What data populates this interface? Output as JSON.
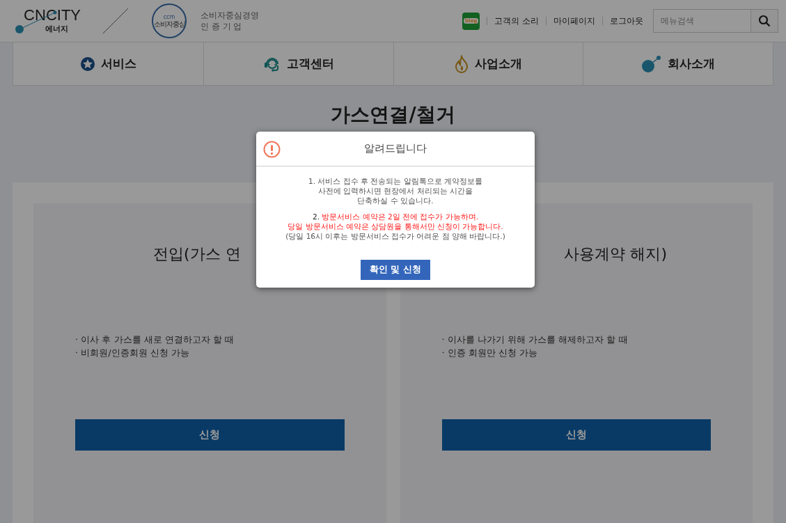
{
  "header": {
    "logo": {
      "brand": "CNCITY",
      "sub": "에너지"
    },
    "badge": {
      "top": "ccm",
      "main": "소비자중심"
    },
    "cert_lines": [
      "소비자중심경영",
      "인 증 기 업"
    ],
    "blog_label": "blog",
    "links": [
      "고객의 소리",
      "마이페이지",
      "로그아웃"
    ],
    "search": {
      "placeholder": "메뉴검색"
    }
  },
  "nav": [
    {
      "kind": "star",
      "label": "서비스"
    },
    {
      "kind": "headset",
      "label": "고객센터"
    },
    {
      "kind": "flame",
      "label": "사업소개"
    },
    {
      "kind": "dot",
      "label": "회사소개"
    }
  ],
  "page_title": "가스연결/철거",
  "cards": [
    {
      "title": "전입(가스 연",
      "bullets": [
        "· 이사 후 가스를 새로 연결하고자 할 때",
        "· 비회원/인증회원 신청 가능"
      ],
      "button": "신청"
    },
    {
      "title": "사용계약 해지)",
      "bullets": [
        "· 이사를 나가기 위해 가스를 해제하고자 할 때",
        "· 인증 회원만 신청 가능"
      ],
      "button": "신청"
    }
  ],
  "modal": {
    "title": "알려드립니다",
    "paragraphs": [
      {
        "kind": "plain",
        "lines": [
          "1. 서비스 접수 후 전송되는 알림톡으로 계약정보를",
          "사전에 입력하시면 현장에서 처리되는 시간을",
          "단축하실 수 있습니다."
        ]
      },
      {
        "kind": "notice",
        "number": "2.",
        "red_lines": [
          "방문서비스 예약은 2일 전에 접수가 가능하며.",
          "당일 방문서비스 예약은 상담원을 통해서만 신청이 가능합니다."
        ],
        "note": "(당일 16시 이후는 방문서비스 접수가 어려운 점 양해 바랍니다.)"
      }
    ],
    "button": "확인 및 신청"
  }
}
